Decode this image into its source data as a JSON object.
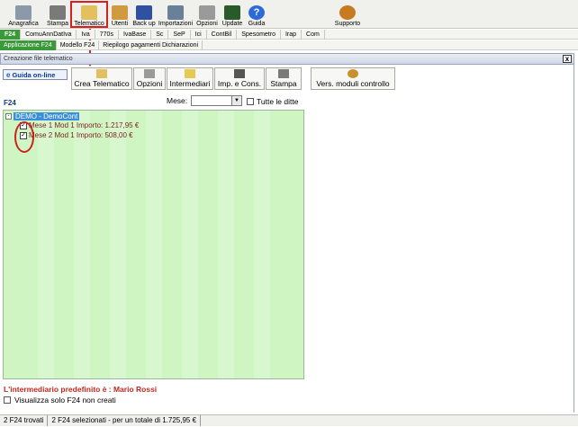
{
  "toolbar": {
    "buttons": [
      {
        "label": "Anagrafica",
        "icon": "id-card-icon",
        "color": "#7a8a9a"
      },
      {
        "label": "Stampa",
        "icon": "printer-icon",
        "color": "#6a6a6a"
      },
      {
        "label": "Telematico",
        "icon": "pencil-icon",
        "color": "#d8b040"
      },
      {
        "label": "Utenti",
        "icon": "users-icon",
        "color": "#c8903a"
      },
      {
        "label": "Back up",
        "icon": "books-icon",
        "color": "#3050a0"
      },
      {
        "label": "Importazioni",
        "icon": "import-icon",
        "color": "#607890"
      },
      {
        "label": "Opzioni",
        "icon": "wrench-icon",
        "color": "#8a8a8a"
      },
      {
        "label": "Update",
        "icon": "monitor-icon",
        "color": "#2a5a2a"
      },
      {
        "label": "Guida",
        "icon": "help-icon",
        "color": "#2d6ad8"
      },
      {
        "label": "Supporto",
        "icon": "support-icon",
        "color": "#c87a20"
      }
    ]
  },
  "tabs_main": [
    "F24",
    "ComuAnnDatIva",
    "Iva",
    "770s",
    "IvaBase",
    "Sc",
    "SeP",
    "Ici",
    "ContBil",
    "Spesometro",
    "Irap",
    "Com"
  ],
  "tabs_sub": [
    "Applicazione F24",
    "Modello F24",
    "Riepilogo pagamenti Dichiarazioni"
  ],
  "window": {
    "title": "Creazione file telematico",
    "close": "x"
  },
  "guida": {
    "label": "Guida on-line",
    "icon": "e"
  },
  "function_buttons": [
    {
      "label": "Crea Telematico",
      "icon": "pencil-icon"
    },
    {
      "label": "Opzioni",
      "icon": "wrench-icon"
    },
    {
      "label": "Intermediari",
      "icon": "folder-icon"
    },
    {
      "label": "Imp. e Cons.",
      "icon": "calculator-icon"
    },
    {
      "label": "Stampa",
      "icon": "printer-icon"
    },
    {
      "label": "Vers. moduli controllo",
      "icon": "magnifier-icon"
    }
  ],
  "section_label": "F24",
  "mese": {
    "label": "Mese:",
    "value": ""
  },
  "tutte_label": "Tutte le ditte",
  "tree": {
    "root": "DEMO - DemoCont",
    "expander": "-",
    "items": [
      {
        "label": "Mese 1 Mod 1 Importo: 1.217,95 €",
        "checked": true
      },
      {
        "label": "Mese 2 Mod 1 Importo: 508,00 €",
        "checked": true
      }
    ]
  },
  "intermediario": "L'intermediario predefinito è : Mario Rossi",
  "visualizza_label": "Visualizza solo F24 non creati",
  "status": [
    "2 F24 trovati",
    "2 F24 selezionati - per un totale di 1.725,95 €"
  ]
}
